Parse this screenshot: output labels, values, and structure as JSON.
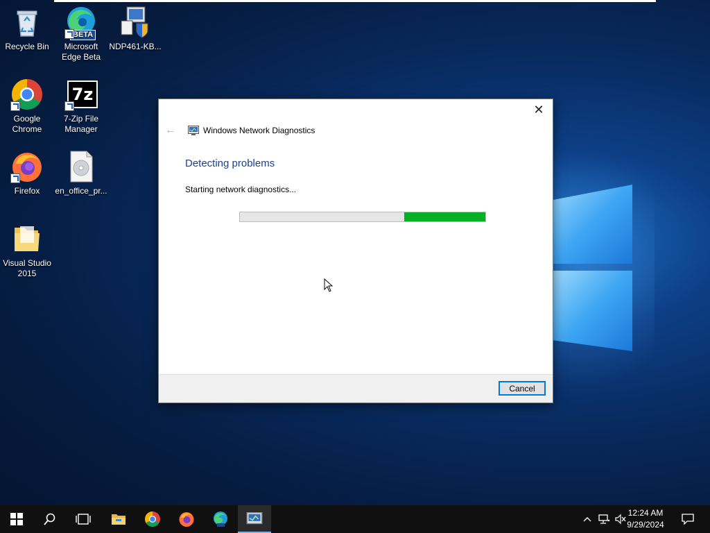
{
  "desktop": {
    "icons": [
      {
        "label": "Recycle Bin"
      },
      {
        "label": "Microsoft Edge Beta"
      },
      {
        "label": "NDP461-KB..."
      },
      {
        "label": "Google Chrome"
      },
      {
        "label": "7-Zip File Manager"
      },
      {
        "label": "Firefox"
      },
      {
        "label": "en_office_pr..."
      },
      {
        "label": "Visual Studio 2015"
      }
    ],
    "edge_badge": "BETA",
    "sevenzip_badge": "7z"
  },
  "dialog": {
    "window_title": "Windows Network Diagnostics",
    "heading": "Detecting problems",
    "status": "Starting network diagnostics...",
    "progress_percent": 33,
    "cancel_label": "Cancel",
    "close_glyph": "✕",
    "back_glyph": "←"
  },
  "taskbar": {
    "time": "12:24 AM",
    "date": "9/29/2024",
    "apps": [
      "start",
      "search",
      "task-view",
      "file-explorer",
      "chrome",
      "firefox",
      "edge-beta",
      "network-diagnostics"
    ]
  },
  "colors": {
    "progress_fill": "#06b025",
    "heading": "#1e3f8a",
    "accent": "#0078d7"
  }
}
